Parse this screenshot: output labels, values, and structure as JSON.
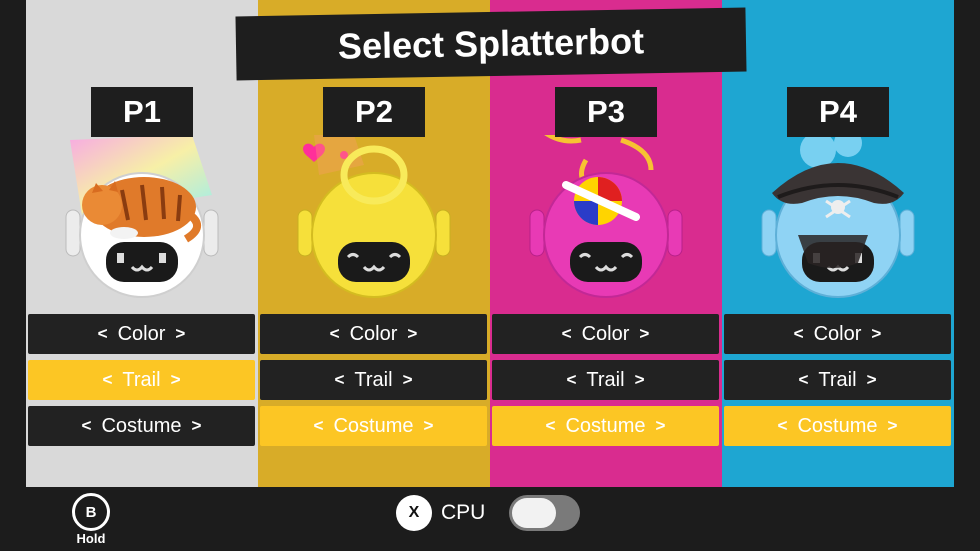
{
  "title": "Select Splatterbot",
  "colors": {
    "selected_option": "#fcc624",
    "unselected_option": "#222222"
  },
  "players": [
    {
      "tag": "P1",
      "panel_color": "#d9d9d9",
      "robot_body_color": "#ffffff",
      "costume_icon": "tabby-cat-costume",
      "options": {
        "color": "Color",
        "trail": "Trail",
        "costume": "Costume"
      },
      "selected": "trail"
    },
    {
      "tag": "P2",
      "panel_color": "#d8ac28",
      "robot_body_color": "#f6e03a",
      "costume_icon": "yellow-ring-costume",
      "options": {
        "color": "Color",
        "trail": "Trail",
        "costume": "Costume"
      },
      "selected": "costume"
    },
    {
      "tag": "P3",
      "panel_color": "#d92c8f",
      "robot_body_color": "#e83ab5",
      "costume_icon": "beach-ball-propeller-costume",
      "options": {
        "color": "Color",
        "trail": "Trail",
        "costume": "Costume"
      },
      "selected": "costume"
    },
    {
      "tag": "P4",
      "panel_color": "#1ea6d2",
      "robot_body_color": "#8fd3f4",
      "costume_icon": "pirate-hat-costume",
      "options": {
        "color": "Color",
        "trail": "Trail",
        "costume": "Costume"
      },
      "selected": "costume"
    }
  ],
  "bottom_bar": {
    "b_button": "B",
    "hold_label": "Hold",
    "x_button": "X",
    "cpu_label": "CPU",
    "cpu_enabled": false
  }
}
